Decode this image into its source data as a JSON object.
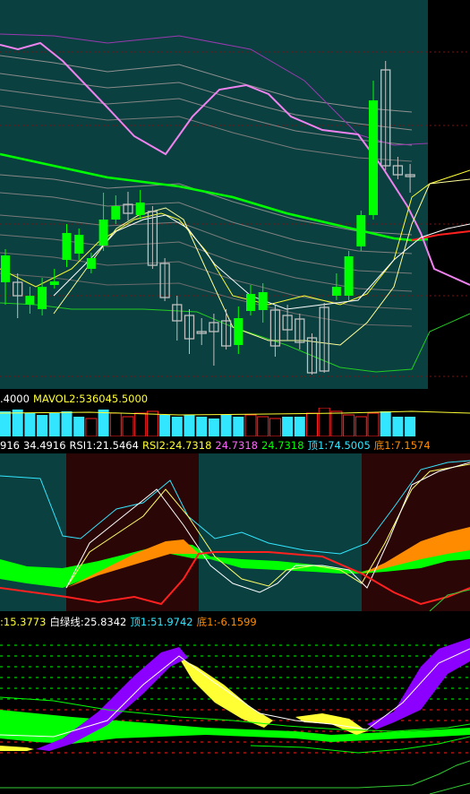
{
  "colors": {
    "up": "#00ff00",
    "down": "#c0c0c0",
    "teal": "#0a4040",
    "maroon": "#2a0606",
    "yellow": "#ffff33",
    "cyan": "#33e6ff",
    "red": "#ff2020",
    "pink": "#ee82ee",
    "orange": "#ff8c00",
    "purple": "#8b00ff"
  },
  "volume_info": {
    "left": ".4000",
    "mavol2": "MAVOL2:536045.5000"
  },
  "rsi_info": {
    "prefix": "916",
    "v1": "34.4916",
    "rsi1": "RSI1:21.5464",
    "rsi2": "RSI2:24.7318",
    "v2": "24.7318",
    "v3": "24.7318",
    "top": "顶1:74.5005",
    "bottom": "底1:7.1574"
  },
  "macd_info": {
    "v1": ":15.3773",
    "whitegreen": "白绿线:25.8342",
    "top": "顶1:51.9742",
    "bottom": "底1:-6.1599"
  },
  "chart_data": [
    {
      "type": "candlestick",
      "panel": "price",
      "candles": [
        {
          "o": 315,
          "c": 285,
          "h": 278,
          "l": 340
        },
        {
          "o": 315,
          "c": 330,
          "h": 305,
          "l": 355
        },
        {
          "o": 340,
          "c": 330,
          "h": 320,
          "l": 350
        },
        {
          "o": 345,
          "c": 320,
          "h": 310,
          "l": 352
        },
        {
          "o": 318,
          "c": 314,
          "h": 300,
          "l": 322
        },
        {
          "o": 290,
          "c": 260,
          "h": 250,
          "l": 298
        },
        {
          "o": 283,
          "c": 262,
          "h": 255,
          "l": 290
        },
        {
          "o": 300,
          "c": 288,
          "h": 282,
          "l": 305
        },
        {
          "o": 274,
          "c": 245,
          "h": 215,
          "l": 280
        },
        {
          "o": 245,
          "c": 230,
          "h": 218,
          "l": 250
        },
        {
          "o": 228,
          "c": 238,
          "h": 214,
          "l": 246
        },
        {
          "o": 240,
          "c": 226,
          "h": 212,
          "l": 245
        },
        {
          "o": 236,
          "c": 296,
          "h": 230,
          "l": 300
        },
        {
          "o": 294,
          "c": 332,
          "h": 288,
          "l": 336
        },
        {
          "o": 340,
          "c": 358,
          "h": 330,
          "l": 380
        },
        {
          "o": 352,
          "c": 378,
          "h": 345,
          "l": 395
        },
        {
          "o": 370,
          "c": 372,
          "h": 355,
          "l": 385
        },
        {
          "o": 360,
          "c": 370,
          "h": 350,
          "l": 408
        },
        {
          "o": 358,
          "c": 386,
          "h": 345,
          "l": 390
        },
        {
          "o": 385,
          "c": 355,
          "h": 342,
          "l": 395
        },
        {
          "o": 347,
          "c": 328,
          "h": 318,
          "l": 352
        },
        {
          "o": 346,
          "c": 326,
          "h": 316,
          "l": 360
        },
        {
          "o": 346,
          "c": 386,
          "h": 340,
          "l": 398
        },
        {
          "o": 352,
          "c": 368,
          "h": 340,
          "l": 380
        },
        {
          "o": 356,
          "c": 382,
          "h": 350,
          "l": 390
        },
        {
          "o": 377,
          "c": 416,
          "h": 372,
          "l": 418
        },
        {
          "o": 343,
          "c": 414,
          "h": 338,
          "l": 416
        },
        {
          "o": 330,
          "c": 320,
          "h": 305,
          "l": 335
        },
        {
          "o": 330,
          "c": 286,
          "h": 280,
          "l": 335
        },
        {
          "o": 275,
          "c": 240,
          "h": 235,
          "l": 280
        },
        {
          "o": 240,
          "c": 112,
          "h": 90,
          "l": 245
        },
        {
          "o": 78,
          "c": 185,
          "h": 68,
          "l": 190
        },
        {
          "o": 185,
          "c": 195,
          "h": 175,
          "l": 200
        },
        {
          "o": 195,
          "c": 197,
          "h": 183,
          "l": 215
        }
      ]
    },
    {
      "type": "bar",
      "panel": "volume",
      "values": [
        28,
        30,
        26,
        24,
        26,
        28,
        22,
        20,
        30,
        26,
        22,
        26,
        28,
        24,
        22,
        24,
        22,
        20,
        24,
        22,
        24,
        22,
        20,
        22,
        22,
        26,
        32,
        28,
        24,
        22,
        26,
        28,
        22,
        22
      ]
    },
    {
      "type": "line",
      "panel": "rsi",
      "series": [
        "RSI1",
        "RSI2"
      ]
    },
    {
      "type": "area",
      "panel": "macd"
    }
  ]
}
